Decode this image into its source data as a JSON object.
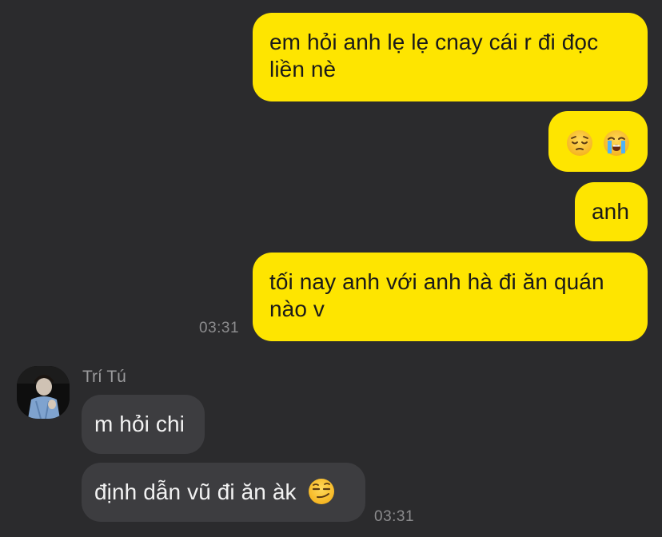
{
  "conversation": {
    "outgoing": [
      {
        "text": "em hỏi anh lẹ lẹ cnay cái r đi đọc liền nè"
      },
      {
        "emojis": [
          "pensive-face-emoji",
          "loudly-crying-face-emoji"
        ]
      },
      {
        "text": "anh"
      },
      {
        "text": "tối nay anh với anh hà đi ăn quán nào v",
        "time": "03:31"
      }
    ],
    "incoming": {
      "sender": "Trí Tú",
      "messages": [
        {
          "text": "m hỏi chi"
        },
        {
          "text": "định dẫn vũ đi ăn àk",
          "emoji": "smirking-face-emoji",
          "time": "03:31"
        }
      ]
    }
  },
  "colors": {
    "background": "#2b2b2d",
    "outgoing_bubble": "#fee500",
    "incoming_bubble": "#3d3d40",
    "timestamp": "#8c8c8e"
  }
}
